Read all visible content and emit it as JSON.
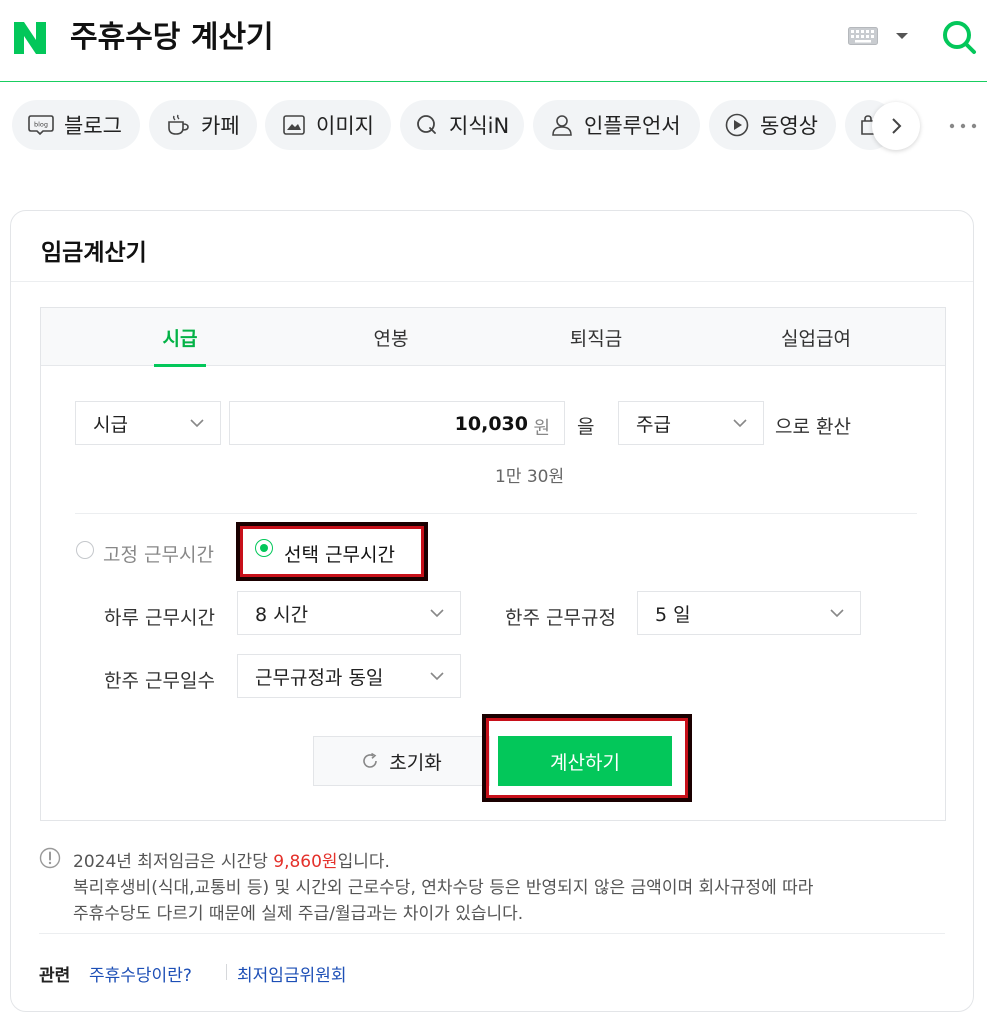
{
  "header": {
    "title": "주휴수당 계산기",
    "logo_letter": "N",
    "brand_color": "#03c75a"
  },
  "verticals": [
    {
      "label": "블로그",
      "icon": "blog-icon"
    },
    {
      "label": "카페",
      "icon": "cafe-cup-icon"
    },
    {
      "label": "이미지",
      "icon": "image-icon"
    },
    {
      "label": "지식iN",
      "icon": "kin-icon"
    },
    {
      "label": "인플루언서",
      "icon": "person-icon"
    },
    {
      "label": "동영상",
      "icon": "play-icon"
    }
  ],
  "card": {
    "title": "임금계산기"
  },
  "calc": {
    "tabs": [
      "시급",
      "연봉",
      "퇴직금",
      "실업급여"
    ],
    "active_tab": 0,
    "pay_type": "시급",
    "amount": "10,030",
    "amount_unit": "원",
    "particle": "을",
    "target_type": "주급",
    "convert_label": "으로 환산",
    "amount_readout": "1만 30원",
    "radio_fixed": "고정 근무시간",
    "radio_selected": "선택 근무시간",
    "daily_hours_label": "하루 근무시간",
    "daily_hours_value": "8 시간",
    "weekly_rule_label": "한주 근무규정",
    "weekly_rule_value": "5 일",
    "weekly_days_label": "한주 근무일수",
    "weekly_days_value": "근무규정과 동일",
    "reset_label": "초기화",
    "calc_label": "계산하기"
  },
  "notice": {
    "line1_prefix": "2024년 최저임금은 시간당 ",
    "line1_highlight": "9,860원",
    "line1_suffix": "입니다.",
    "line2": "복리후생비(식대,교통비 등) 및 시간외 근로수당, 연차수당 등은 반영되지 않은 금액이며 회사규정에 따라",
    "line3": "주휴수당도 다르기 때문에 실제 주급/월급과는 차이가 있습니다."
  },
  "related": {
    "label": "관련",
    "links": [
      "주휴수당이란?",
      "최저임금위원회"
    ]
  }
}
